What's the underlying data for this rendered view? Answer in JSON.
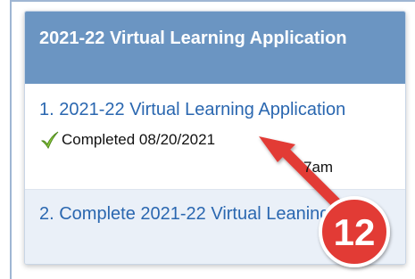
{
  "panel": {
    "title": "2021-22 Virtual Learning Application",
    "items": [
      {
        "label": "1. 2021-22 Virtual Learning Application",
        "status": "Completed 08/20/2021",
        "status_time_fragment": "7am",
        "status_icon": "check-icon"
      },
      {
        "label": "2. Complete 2021-22 Virtual Leaning App."
      }
    ]
  },
  "annotation": {
    "badge_number": "12",
    "badge_color": "#e23a36",
    "arrow_color": "#e23a36"
  },
  "colors": {
    "header_bg": "#6b95c2",
    "link": "#2a67b0",
    "row_alt_bg": "#eaf0f8"
  }
}
